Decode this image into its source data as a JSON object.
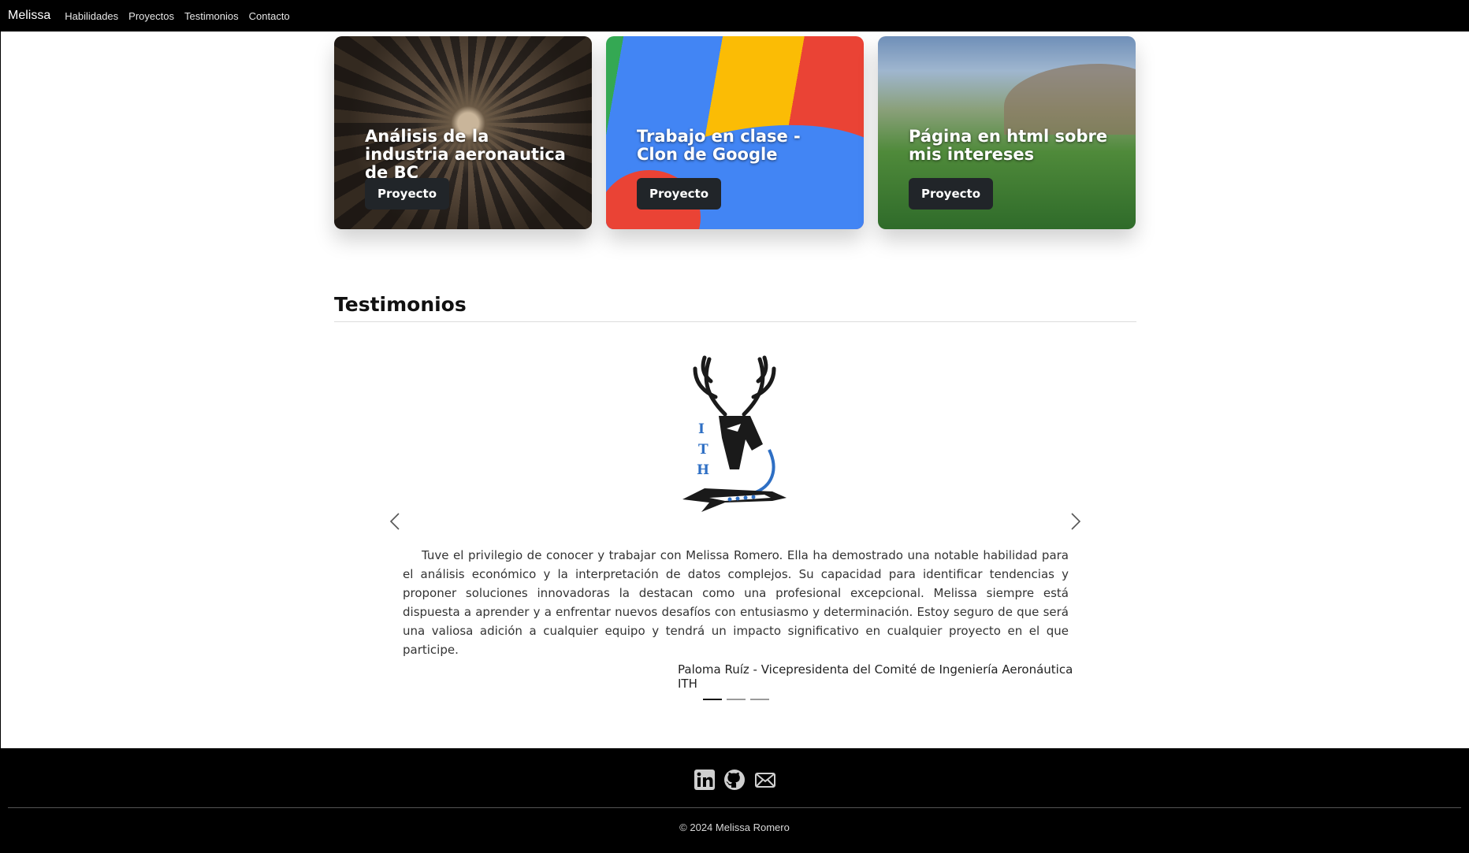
{
  "nav": {
    "brand": "Melissa",
    "links": [
      "Habilidades",
      "Proyectos",
      "Testimonios",
      "Contacto"
    ]
  },
  "projects": [
    {
      "title": "Análisis de la industria aeronautica de BC",
      "button": "Proyecto"
    },
    {
      "title": "Trabajo en clase - Clon de Google",
      "button": "Proyecto"
    },
    {
      "title": "Página en html sobre mis intereses",
      "button": "Proyecto"
    }
  ],
  "testimonials": {
    "title": "Testimonios",
    "logo_letters": [
      "I",
      "T",
      "H"
    ],
    "quote": "Tuve el privilegio de conocer y trabajar con Melissa Romero. Ella ha demostrado una notable habilidad para el análisis económico y la interpretación de datos complejos. Su capacidad para identificar tendencias y proponer soluciones innovadoras la destacan como una profesional excepcional. Melissa siempre está dispuesta a aprender y a enfrentar nuevos desafíos con entusiasmo y determinación. Estoy seguro de que será una valiosa adición a cualquier equipo y tendrá un impacto significativo en cualquier proyecto en el que participe.",
    "author": "Paloma Ruíz - Vicepresidenta del Comité de Ingeniería Aeronáutica ITH",
    "slide_count": 3,
    "active_slide": 1
  },
  "footer": {
    "social_icons": [
      "linkedin-icon",
      "github-icon",
      "mail-icon"
    ],
    "copyright": "© 2024 Melissa Romero"
  },
  "colors": {
    "navbar_bg": "#000000",
    "button_bg": "#212529",
    "ith_blue": "#2e6fc4"
  }
}
